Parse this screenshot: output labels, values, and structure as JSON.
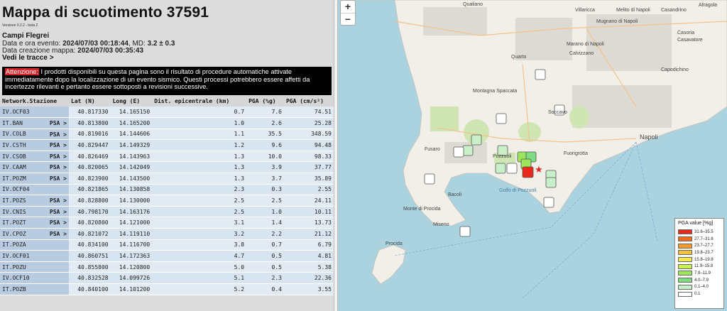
{
  "header": {
    "title": "Mappa di scuotimento 37591",
    "version": "Versione 0.2.2 - beta 2",
    "area": "Campi Flegrei",
    "event_prefix": "Data e ora evento: ",
    "event_value": "2024/07/03 00:18:44",
    "md_prefix": ", MD: ",
    "md_value": "3.2 ± 0.3",
    "map_prefix": "Data creazione mappa: ",
    "map_value": "2024/07/03 00:35:43",
    "traces_link": "Vedi le tracce >"
  },
  "warning": {
    "tag": "Attenzione:",
    "text": " I prodotti disponibili su questa pagina sono il risultato di procedure automatiche attivate immediatamente dopo la localizzazione di un evento sismico. Questi processi potrebbero essere affetti da incertezze rilevanti e pertanto essere sottoposti a revisioni successive."
  },
  "table": {
    "headers": [
      "Network.Stazione",
      "Lat (N)",
      "Long (E)",
      "Dist. epicentrale (km)",
      "PGA (%g)",
      "PGA (cm/s²)"
    ],
    "rows": [
      {
        "station": "IV.OCF03",
        "psa": "",
        "lat": "40.817330",
        "lon": "14.165150",
        "dist": "0.7",
        "pga_g": "7.6",
        "pga_cm": "74.51"
      },
      {
        "station": "IT.BAN",
        "psa": "PSA >",
        "lat": "40.813800",
        "lon": "14.165200",
        "dist": "1.0",
        "pga_g": "2.6",
        "pga_cm": "25.28"
      },
      {
        "station": "IV.COLB",
        "psa": "PSA >",
        "lat": "40.819016",
        "lon": "14.144606",
        "dist": "1.1",
        "pga_g": "35.5",
        "pga_cm": "348.59"
      },
      {
        "station": "IV.CSTH",
        "psa": "PSA >",
        "lat": "40.829447",
        "lon": "14.149329",
        "dist": "1.2",
        "pga_g": "9.6",
        "pga_cm": "94.48"
      },
      {
        "station": "IV.CSOB",
        "psa": "PSA >",
        "lat": "40.826469",
        "lon": "14.143963",
        "dist": "1.3",
        "pga_g": "10.0",
        "pga_cm": "98.33"
      },
      {
        "station": "IV.CAAM",
        "psa": "PSA >",
        "lat": "40.820065",
        "lon": "14.142049",
        "dist": "1.3",
        "pga_g": "3.9",
        "pga_cm": "37.77"
      },
      {
        "station": "IT.POZM",
        "psa": "PSA >",
        "lat": "40.823900",
        "lon": "14.143500",
        "dist": "1.3",
        "pga_g": "3.7",
        "pga_cm": "35.89"
      },
      {
        "station": "IV.OCF04",
        "psa": "",
        "lat": "40.821865",
        "lon": "14.130858",
        "dist": "2.3",
        "pga_g": "0.3",
        "pga_cm": "2.55"
      },
      {
        "station": "IT.POZS",
        "psa": "PSA >",
        "lat": "40.828800",
        "lon": "14.130000",
        "dist": "2.5",
        "pga_g": "2.5",
        "pga_cm": "24.11"
      },
      {
        "station": "IV.CNIS",
        "psa": "PSA >",
        "lat": "40.798170",
        "lon": "14.163176",
        "dist": "2.5",
        "pga_g": "1.0",
        "pga_cm": "10.11"
      },
      {
        "station": "IT.POZT",
        "psa": "PSA >",
        "lat": "40.820800",
        "lon": "14.121000",
        "dist": "3.1",
        "pga_g": "1.4",
        "pga_cm": "13.73"
      },
      {
        "station": "IV.CPOZ",
        "psa": "PSA >",
        "lat": "40.821072",
        "lon": "14.119110",
        "dist": "3.2",
        "pga_g": "2.2",
        "pga_cm": "21.12"
      },
      {
        "station": "IT.POZA",
        "psa": "",
        "lat": "40.834100",
        "lon": "14.116700",
        "dist": "3.8",
        "pga_g": "0.7",
        "pga_cm": "6.79"
      },
      {
        "station": "IV.OCF01",
        "psa": "",
        "lat": "40.860751",
        "lon": "14.172363",
        "dist": "4.7",
        "pga_g": "0.5",
        "pga_cm": "4.81"
      },
      {
        "station": "IT.POZU",
        "psa": "",
        "lat": "40.855800",
        "lon": "14.120800",
        "dist": "5.0",
        "pga_g": "0.5",
        "pga_cm": "5.38"
      },
      {
        "station": "IV.OCF10",
        "psa": "",
        "lat": "40.832528",
        "lon": "14.099726",
        "dist": "5.1",
        "pga_g": "2.3",
        "pga_cm": "22.36"
      },
      {
        "station": "IT.POZB",
        "psa": "",
        "lat": "40.840100",
        "lon": "14.101200",
        "dist": "5.2",
        "pga_g": "0.4",
        "pga_cm": "3.55"
      }
    ]
  },
  "map": {
    "zoom_in": "+",
    "zoom_out": "−",
    "places": [
      "Qualiano",
      "Villaricca",
      "Melito di Napoli",
      "Casandrino",
      "Afragola",
      "Mugnano di Napoli",
      "Marano di Napoli",
      "Casoria",
      "Calvizzano",
      "Casavatore",
      "Quarto",
      "Capodichino",
      "Montagna Spaccata",
      "Soccavo",
      "Fuorigrotta",
      "Pozzuoli",
      "Napoli",
      "Bacoli",
      "Monte di Procida",
      "Golfo di Pozzuoli",
      "Procida",
      "Miseno",
      "Fusaro"
    ],
    "epicenter_icon": "star-icon",
    "colors": {
      "water": "#aad3df",
      "land": "#f2efe9",
      "green": "#cfe6b4",
      "epicenter": "#e52320"
    }
  },
  "legend": {
    "title": "PGA value [%g]",
    "items": [
      {
        "label": "31.6–35.5",
        "color": "#e8291c"
      },
      {
        "label": "27.7–31.6",
        "color": "#ef6c1f"
      },
      {
        "label": "23.7–27.7",
        "color": "#f39a2a"
      },
      {
        "label": "19.8–23.7",
        "color": "#f7c137"
      },
      {
        "label": "15.8–19.8",
        "color": "#f4e94a"
      },
      {
        "label": "11.9–15.8",
        "color": "#cdef4c"
      },
      {
        "label": "7.9–11.9",
        "color": "#9be65a"
      },
      {
        "label": "4.0–7.9",
        "color": "#7fdc83"
      },
      {
        "label": "0.1–4.0",
        "color": "#c9efc8"
      },
      {
        "label": "0.1",
        "color": "#ffffff"
      }
    ]
  }
}
